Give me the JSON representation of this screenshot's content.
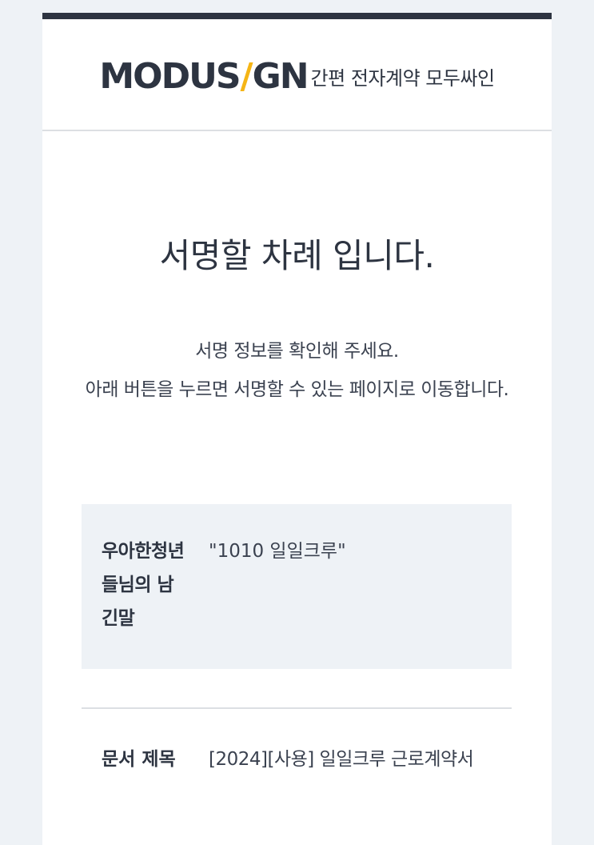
{
  "header": {
    "logo_left": "MODUS",
    "logo_slash": "/",
    "logo_right": "GN",
    "tagline": "간편 전자계약 모두싸인"
  },
  "main": {
    "title": "서명할 차례 입니다.",
    "desc_line1": "서명 정보를 확인해 주세요.",
    "desc_line2": "아래 버튼을 누르면 서명할 수 있는 페이지로 이동합니다."
  },
  "message": {
    "label": "우아한청년들님의 남긴말",
    "value": "\"1010 일일크루\""
  },
  "document": {
    "label": "문서 제목",
    "value": "[2024][사용] 일일크루 근로계약서"
  },
  "colors": {
    "brand_dark": "#2d3441",
    "brand_accent": "#f5b515",
    "panel_bg": "#eef2f6"
  }
}
